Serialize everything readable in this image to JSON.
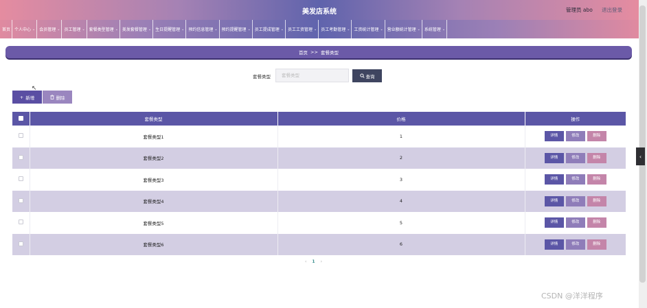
{
  "header": {
    "title": "美发店系统",
    "admin": "管理员 abo",
    "logout": "退出登录"
  },
  "nav": [
    {
      "label": "首页",
      "caret": false
    },
    {
      "label": "个人中心",
      "caret": true
    },
    {
      "label": "会员管理",
      "caret": true
    },
    {
      "label": "员工管理",
      "caret": true
    },
    {
      "label": "套餐类型管理",
      "caret": true
    },
    {
      "label": "美发套餐管理",
      "caret": true
    },
    {
      "label": "生日提醒管理",
      "caret": true
    },
    {
      "label": "预约信息管理",
      "caret": true
    },
    {
      "label": "预约提醒管理",
      "caret": true
    },
    {
      "label": "员工提成管理",
      "caret": true
    },
    {
      "label": "员工工资管理",
      "caret": true
    },
    {
      "label": "员工考勤管理",
      "caret": true
    },
    {
      "label": "工资统计管理",
      "caret": true
    },
    {
      "label": "营业额统计管理",
      "caret": true
    },
    {
      "label": "系统管理",
      "caret": true
    }
  ],
  "breadcrumb": {
    "home": "首页",
    "sep": ">>",
    "current": "套餐类型"
  },
  "search": {
    "label": "套餐类型",
    "placeholder": "套餐类型",
    "value": "",
    "button": "查询"
  },
  "actions": {
    "add": "新增",
    "delete": "删除"
  },
  "table": {
    "headers": [
      "套餐类型",
      "价格",
      "操作"
    ],
    "rows": [
      {
        "name": "套餐类型1",
        "price": "1"
      },
      {
        "name": "套餐类型2",
        "price": "2"
      },
      {
        "name": "套餐类型3",
        "price": "3"
      },
      {
        "name": "套餐类型4",
        "price": "4"
      },
      {
        "name": "套餐类型5",
        "price": "5"
      },
      {
        "name": "套餐类型6",
        "price": "6"
      }
    ],
    "row_actions": {
      "detail": "详情",
      "edit": "修改",
      "remove": "删除"
    }
  },
  "pagination": {
    "prev": "‹",
    "current": "1",
    "next": "›"
  },
  "watermark": "CSDN @洋洋程序",
  "colors": {
    "primary": "#5b56a6",
    "row_alt": "#d3cee3",
    "edit": "#8f7db9",
    "remove": "#c485a9"
  }
}
